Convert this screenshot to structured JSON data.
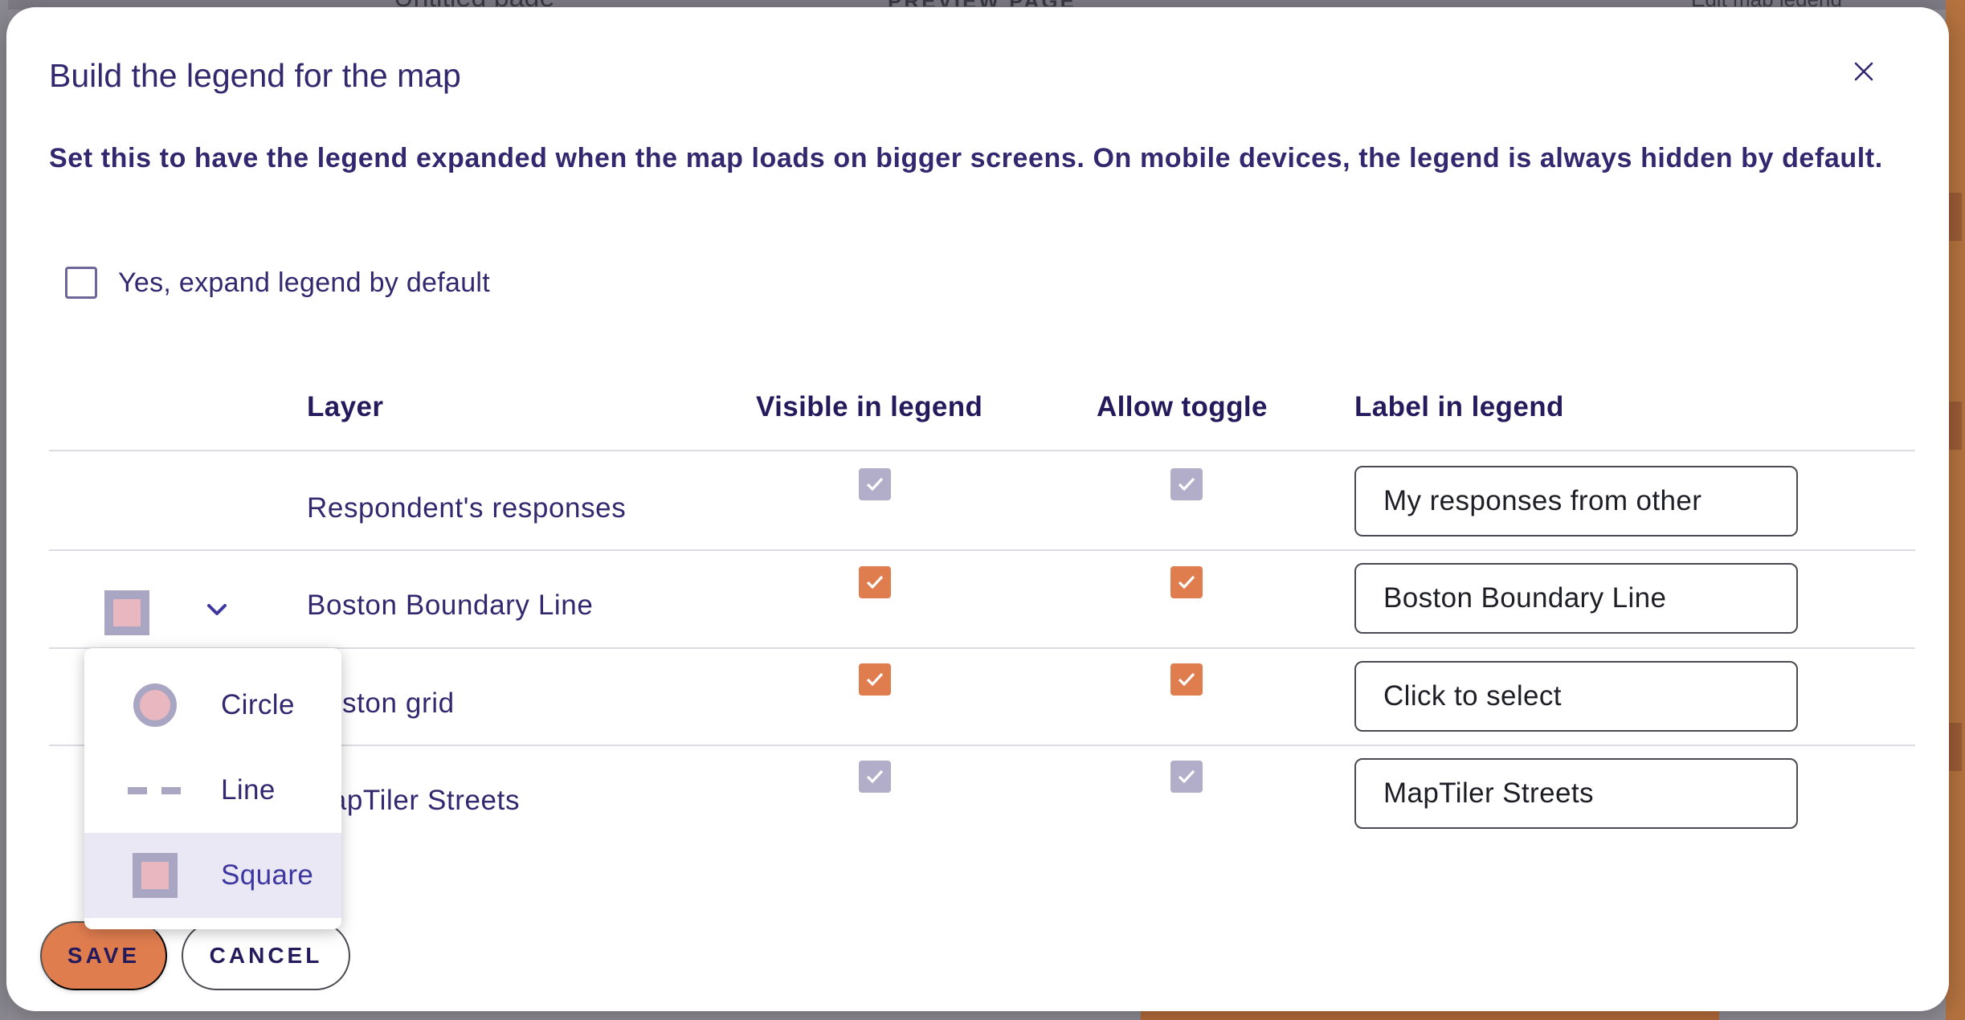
{
  "background": {
    "page_title": "Untitled page",
    "preview_button": "PREVIEW PAGE",
    "edit_legend_link": "Edit map legend"
  },
  "modal": {
    "title": "Build the legend for the map",
    "intro": "Set this to have the legend expanded when the map loads on bigger screens. On mobile devices, the legend is always hidden by default.",
    "expand_checkbox": {
      "label": "Yes, expand legend by default",
      "checked": false
    }
  },
  "table": {
    "headers": {
      "layer": "Layer",
      "visible": "Visible in legend",
      "toggle": "Allow toggle",
      "label": "Label in legend"
    },
    "rows": [
      {
        "layer": "Respondent's responses",
        "visible": true,
        "allow_toggle": true,
        "label_value": "My responses from other",
        "editable": false
      },
      {
        "layer": "Boston Boundary Line",
        "visible": true,
        "allow_toggle": true,
        "label_value": "Boston Boundary Line",
        "editable": true,
        "symbol": "square"
      },
      {
        "layer": "Boston grid",
        "visible": true,
        "allow_toggle": true,
        "label_value": "Click to select",
        "editable": true
      },
      {
        "layer": "MapTiler Streets",
        "visible": true,
        "allow_toggle": true,
        "label_value": "MapTiler Streets",
        "editable": false
      }
    ]
  },
  "symbol_menu": {
    "options": [
      {
        "label": "Circle",
        "icon": "circle-symbol-icon"
      },
      {
        "label": "Line",
        "icon": "line-symbol-icon"
      },
      {
        "label": "Square",
        "icon": "square-symbol-icon",
        "selected": true
      }
    ]
  },
  "footer": {
    "save_label": "SAVE",
    "cancel_label": "CANCEL"
  },
  "colors": {
    "primary_text": "#33286f",
    "accent_orange": "#e07d4f",
    "disabled_checkbox": "#b2aeca",
    "selected_item_bg": "#e9e8f4"
  }
}
